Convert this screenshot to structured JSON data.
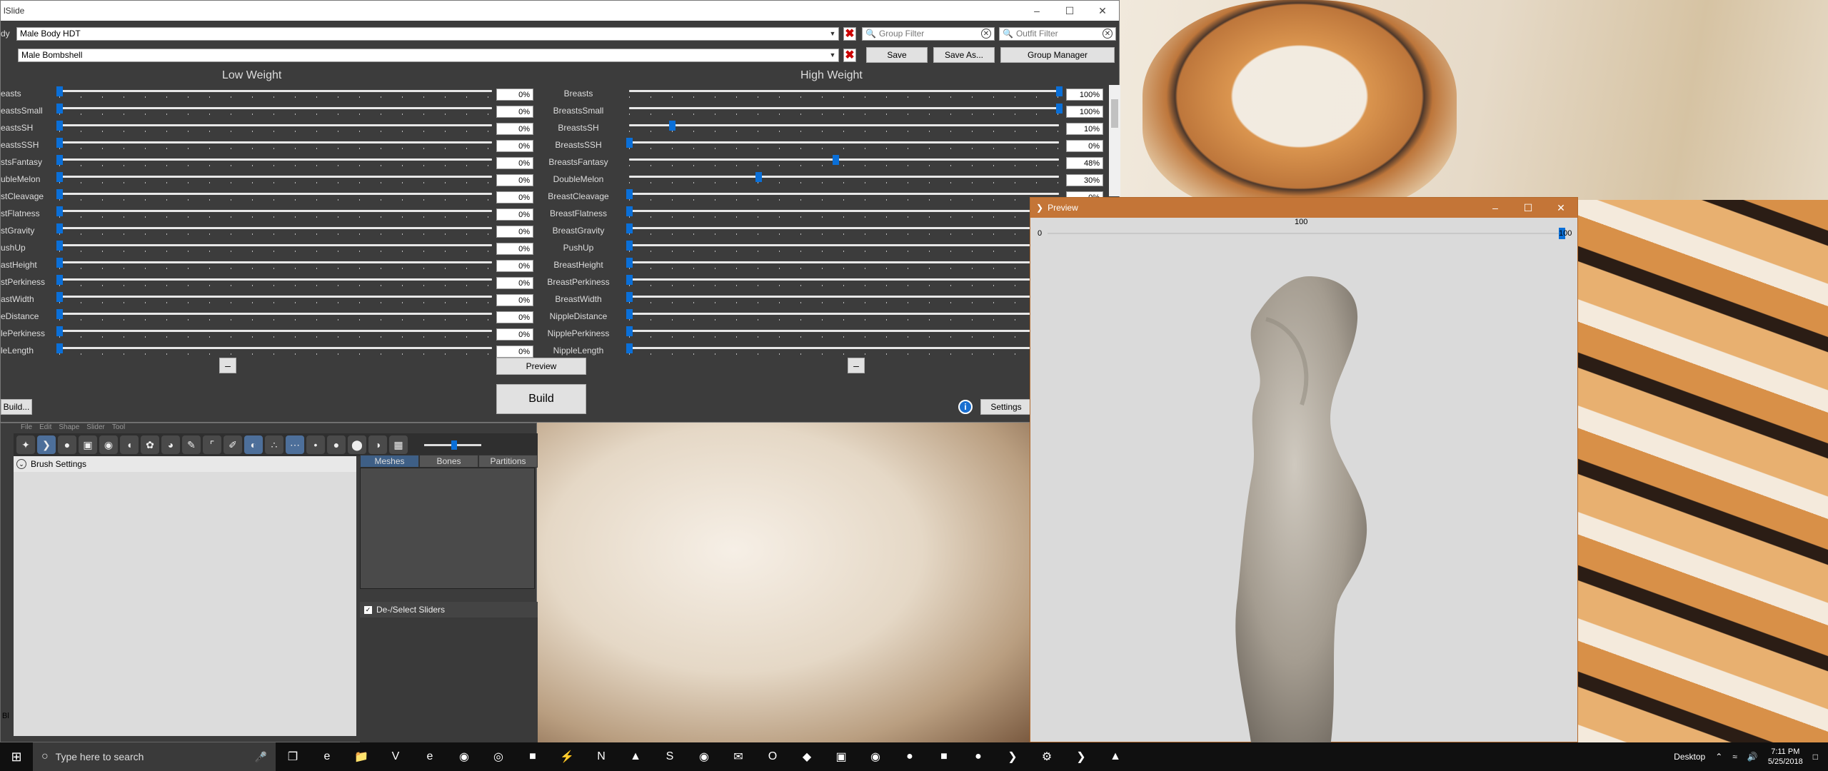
{
  "main_window": {
    "title": "lSlide",
    "body_label": "dy",
    "body_select": "Male Body HDT",
    "preset_select": "Male Bombshell",
    "group_filter_placeholder": "Group Filter",
    "outfit_filter_placeholder": "Outfit Filter",
    "save_label": "Save",
    "save_as_label": "Save As...",
    "group_manager_label": "Group Manager",
    "low_weight_heading": "Low Weight",
    "high_weight_heading": "High Weight",
    "minus_label": "–",
    "preview_label": "Preview",
    "build_label": "Build",
    "build_left_label": "Build...",
    "settings_label": "Settings",
    "info_icon": "info-icon",
    "minimize_icon": "minimize-icon",
    "maximize_icon": "maximize-icon",
    "close_icon": "close-icon"
  },
  "sliders": [
    {
      "left_label": "easts",
      "name": "Breasts",
      "low": "0%",
      "high": "100%",
      "low_val": 0,
      "high_val": 100
    },
    {
      "left_label": "eastsSmall",
      "name": "BreastsSmall",
      "low": "0%",
      "high": "100%",
      "low_val": 0,
      "high_val": 100
    },
    {
      "left_label": "eastsSH",
      "name": "BreastsSH",
      "low": "0%",
      "high": "10%",
      "low_val": 0,
      "high_val": 10
    },
    {
      "left_label": "eastsSSH",
      "name": "BreastsSSH",
      "low": "0%",
      "high": "0%",
      "low_val": 0,
      "high_val": 0
    },
    {
      "left_label": "stsFantasy",
      "name": "BreastsFantasy",
      "low": "0%",
      "high": "48%",
      "low_val": 0,
      "high_val": 48
    },
    {
      "left_label": "ubleMelon",
      "name": "DoubleMelon",
      "low": "0%",
      "high": "30%",
      "low_val": 0,
      "high_val": 30
    },
    {
      "left_label": "stCleavage",
      "name": "BreastCleavage",
      "low": "0%",
      "high": "0%",
      "low_val": 0,
      "high_val": 0
    },
    {
      "left_label": "stFlatness",
      "name": "BreastFlatness",
      "low": "0%",
      "high": "",
      "low_val": 0,
      "high_val": 0
    },
    {
      "left_label": "stGravity",
      "name": "BreastGravity",
      "low": "0%",
      "high": "",
      "low_val": 0,
      "high_val": 0
    },
    {
      "left_label": "ushUp",
      "name": "PushUp",
      "low": "0%",
      "high": "",
      "low_val": 0,
      "high_val": 0
    },
    {
      "left_label": "astHeight",
      "name": "BreastHeight",
      "low": "0%",
      "high": "",
      "low_val": 0,
      "high_val": 0
    },
    {
      "left_label": "stPerkiness",
      "name": "BreastPerkiness",
      "low": "0%",
      "high": "",
      "low_val": 0,
      "high_val": 0
    },
    {
      "left_label": "astWidth",
      "name": "BreastWidth",
      "low": "0%",
      "high": "",
      "low_val": 0,
      "high_val": 0
    },
    {
      "left_label": "eDistance",
      "name": "NippleDistance",
      "low": "0%",
      "high": "",
      "low_val": 0,
      "high_val": 0
    },
    {
      "left_label": "lePerkiness",
      "name": "NipplePerkiness",
      "low": "0%",
      "high": "",
      "low_val": 0,
      "high_val": 0
    },
    {
      "left_label": "leLength",
      "name": "NippleLength",
      "low": "0%",
      "high": "",
      "low_val": 0,
      "high_val": 0
    }
  ],
  "outfit_studio": {
    "menu": [
      "File",
      "Edit",
      "Shape",
      "Slider",
      "Tool"
    ],
    "brush_settings_label": "Brush Settings",
    "tabs": [
      "Meshes",
      "Bones",
      "Partitions"
    ],
    "select_sliders_label": "De-/Select Sliders",
    "side_fragment": "Bl"
  },
  "preview_window": {
    "title": "Preview",
    "min_label": "0",
    "value_label": "100",
    "max_label": "100",
    "weight_value": 100
  },
  "taskbar": {
    "search_placeholder": "Type here to search",
    "desktop_label": "Desktop",
    "time": "7:11 PM",
    "date": "5/25/2018",
    "icons": [
      "task-view-icon",
      "edge-icon",
      "file-explorer-icon",
      "vs-icon",
      "ie-icon",
      "firefox-dev-icon",
      "steam-icon",
      "minecraft-icon",
      "flash-icon",
      "nv-icon",
      "vlc-icon",
      "skype-icon",
      "chrome-icon",
      "mail-icon",
      "opera-icon",
      "misc-icon",
      "photos-icon",
      "firefox-icon",
      "chat-icon",
      "mod-icon",
      "blender-icon",
      "bodyslide-icon",
      "nifskope-icon",
      "bodyslide2-icon",
      "image-icon"
    ]
  }
}
